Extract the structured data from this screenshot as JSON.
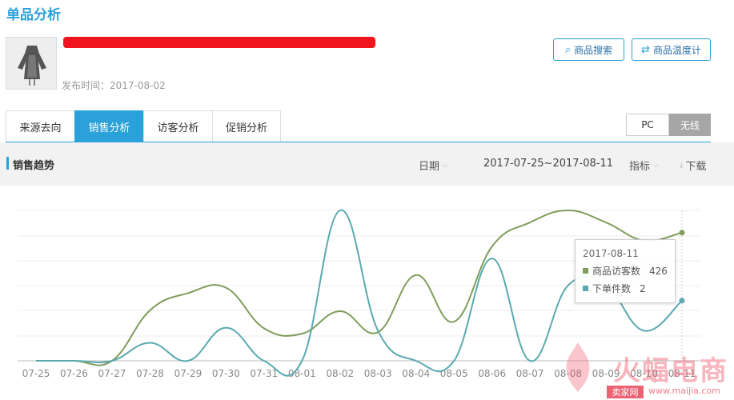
{
  "page": {
    "title": "单品分析"
  },
  "product": {
    "publish_text": "发布时间：2017-08-02"
  },
  "buttons": {
    "search": "商品搜索",
    "temperature": "商品温度计"
  },
  "tabs": [
    {
      "label": "来源去向",
      "active": false
    },
    {
      "label": "销售分析",
      "active": true
    },
    {
      "label": "访客分析",
      "active": false
    },
    {
      "label": "促销分析",
      "active": false
    }
  ],
  "device": {
    "pc": "PC",
    "wireless": "无线",
    "selected": "无线"
  },
  "trend": {
    "title": "销售趋势",
    "date_label": "日期",
    "range": "2017-07-25~2017-08-11",
    "metric_label": "指标",
    "download_label": "下载"
  },
  "chart_data": {
    "type": "line",
    "categories": [
      "07-25",
      "07-26",
      "07-27",
      "07-28",
      "07-29",
      "07-30",
      "07-31",
      "08-01",
      "08-02",
      "08-03",
      "08-04",
      "08-05",
      "08-06",
      "08-07",
      "08-08",
      "08-09",
      "08-10",
      "08-11"
    ],
    "series": [
      {
        "name": "商品访客数",
        "color": "#7f9d5c",
        "values": [
          0,
          0,
          0,
          168,
          225,
          243,
          108,
          90,
          165,
          95,
          285,
          130,
          380,
          460,
          500,
          460,
          400,
          426
        ]
      },
      {
        "name": "下单件数",
        "color": "#5aa9b0",
        "values": [
          0,
          0,
          0,
          0.6,
          0,
          1.1,
          0,
          0,
          5,
          1,
          0,
          0,
          3.4,
          0,
          2.5,
          2.5,
          1,
          2
        ]
      }
    ],
    "grid": true,
    "highlight_index": 17
  },
  "tooltip": {
    "date": "2017-08-11",
    "rows": [
      {
        "label": "商品访客数",
        "value": "426",
        "color": "#7f9d5c"
      },
      {
        "label": "下单件数",
        "value": "2",
        "color": "#5aa9b0"
      }
    ]
  },
  "watermark": {
    "text": "火蝠电商",
    "badge": "卖家网",
    "url": "www.maijia.com"
  }
}
